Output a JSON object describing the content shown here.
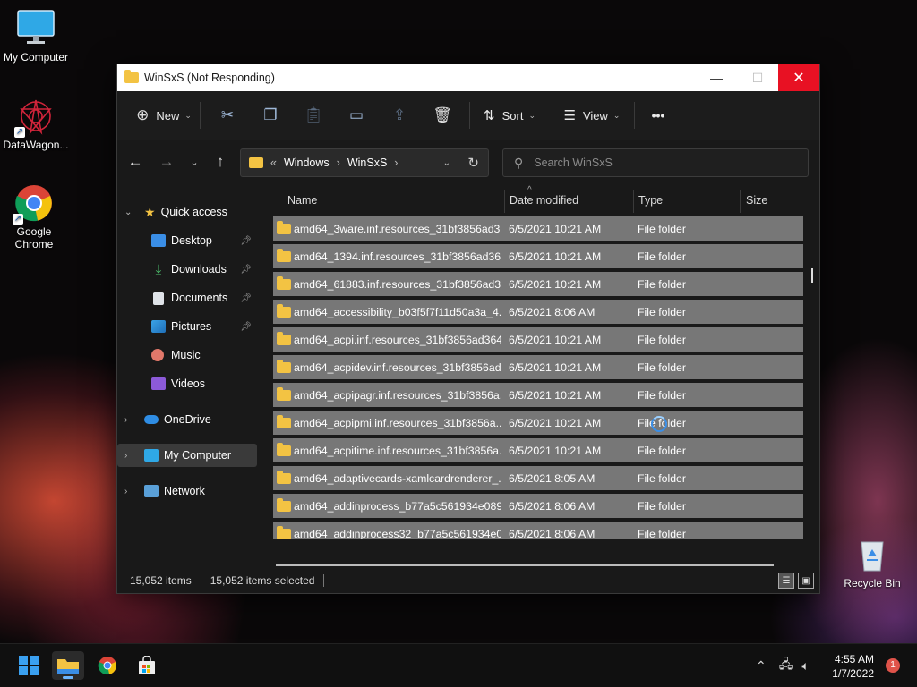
{
  "desktop": {
    "icons": [
      {
        "label": "My Computer"
      },
      {
        "label": "DataWagon..."
      },
      {
        "label": "Google Chrome"
      },
      {
        "label": "Recycle Bin"
      }
    ]
  },
  "window": {
    "title": "WinSxS (Not Responding)",
    "controls": {
      "minimize": "—",
      "maximize": "☐",
      "close": "✕"
    }
  },
  "toolbar": {
    "new_label": "New",
    "sort_label": "Sort",
    "view_label": "View",
    "more_label": "•••",
    "icons": [
      "cut-icon",
      "copy-icon",
      "paste-icon",
      "rename-icon",
      "share-icon",
      "delete-icon"
    ]
  },
  "address": {
    "overflow": "«",
    "crumbs": [
      "Windows",
      "WinSxS"
    ],
    "separator": "›"
  },
  "search": {
    "placeholder": "Search WinSxS"
  },
  "nav": {
    "quick_access": "Quick access",
    "items": [
      {
        "label": "Desktop",
        "pinned": true
      },
      {
        "label": "Downloads",
        "pinned": true
      },
      {
        "label": "Documents",
        "pinned": true
      },
      {
        "label": "Pictures",
        "pinned": true
      },
      {
        "label": "Music",
        "pinned": false
      },
      {
        "label": "Videos",
        "pinned": false
      }
    ],
    "onedrive": "OneDrive",
    "my_computer": "My Computer",
    "network": "Network"
  },
  "columns": {
    "name": "Name",
    "date": "Date modified",
    "type": "Type",
    "size": "Size"
  },
  "rows": [
    {
      "name": "amd64_3ware.inf.resources_31bf3856ad3...",
      "date": "6/5/2021 10:21 AM",
      "type": "File folder"
    },
    {
      "name": "amd64_1394.inf.resources_31bf3856ad36...",
      "date": "6/5/2021 10:21 AM",
      "type": "File folder"
    },
    {
      "name": "amd64_61883.inf.resources_31bf3856ad3...",
      "date": "6/5/2021 10:21 AM",
      "type": "File folder"
    },
    {
      "name": "amd64_accessibility_b03f5f7f11d50a3a_4....",
      "date": "6/5/2021 8:06 AM",
      "type": "File folder"
    },
    {
      "name": "amd64_acpi.inf.resources_31bf3856ad364...",
      "date": "6/5/2021 10:21 AM",
      "type": "File folder"
    },
    {
      "name": "amd64_acpidev.inf.resources_31bf3856ad...",
      "date": "6/5/2021 10:21 AM",
      "type": "File folder"
    },
    {
      "name": "amd64_acpipagr.inf.resources_31bf3856a...",
      "date": "6/5/2021 10:21 AM",
      "type": "File folder"
    },
    {
      "name": "amd64_acpipmi.inf.resources_31bf3856a...",
      "date": "6/5/2021 10:21 AM",
      "type": "File folder"
    },
    {
      "name": "amd64_acpitime.inf.resources_31bf3856a...",
      "date": "6/5/2021 10:21 AM",
      "type": "File folder"
    },
    {
      "name": "amd64_adaptivecards-xamlcardrenderer_...",
      "date": "6/5/2021 8:05 AM",
      "type": "File folder"
    },
    {
      "name": "amd64_addinprocess_b77a5c561934e089...",
      "date": "6/5/2021 8:06 AM",
      "type": "File folder"
    },
    {
      "name": "amd64_addinprocess32_b77a5c561934e0...",
      "date": "6/5/2021 8:06 AM",
      "type": "File folder"
    }
  ],
  "status": {
    "count": "15,052 items",
    "selected": "15,052 items selected"
  },
  "taskbar": {
    "time": "4:55 AM",
    "date": "1/7/2022",
    "notifications": "1"
  },
  "colors": {
    "accent": "#e81123",
    "folder": "#f3c343",
    "selected_row": "#777777"
  }
}
